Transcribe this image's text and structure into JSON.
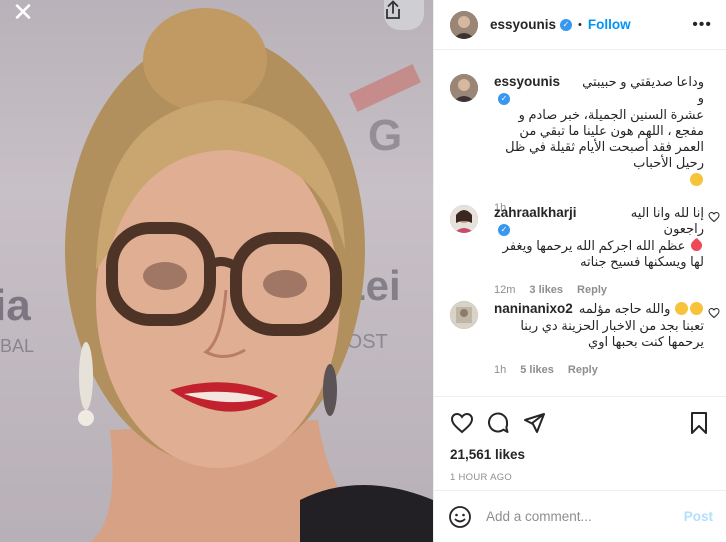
{
  "post": {
    "photo_icons": {
      "close": "close-icon",
      "share": "share-icon"
    }
  },
  "header": {
    "username": "essyounis",
    "separator": "•",
    "follow_label": "Follow",
    "more_icon": "more-options-icon"
  },
  "caption": {
    "username": "essyounis",
    "line1": "وداعا صديقتي و حبيبتي و",
    "text": "عشرة السنين الجميلة، خبر صادم و مفجع ، اللهم هون علينا ما تبقي من العمر فقد أصبحت الأيام ثقيلة في ظل رحيل الأحباب",
    "time": "1h"
  },
  "comments": [
    {
      "username": "zahraalkharji",
      "line1": "إنا لله وانا اليه راجعون",
      "text": "عظم الله اجركم الله يرحمها ويغفر لها ويسكنها فسيح جناته",
      "time": "12m",
      "likes": "3 likes",
      "reply": "Reply"
    },
    {
      "username": "naninanixo2",
      "line1": "والله حاجه مؤلمه",
      "text": "تعبنا بجد من الاخبار الحزينة دي ربنا يرحمها كنت بحبها اوي",
      "time": "1h",
      "likes": "5 likes",
      "reply": "Reply"
    }
  ],
  "actions": {
    "icons": [
      "heart-icon",
      "comment-icon",
      "share-icon",
      "bookmark-icon"
    ],
    "likes": "21,561 likes",
    "timestamp": "1 HOUR AGO"
  },
  "add_comment": {
    "placeholder": "Add a comment...",
    "post_label": "Post"
  },
  "colors": {
    "accent": "#0095f6",
    "verified": "#3897f0",
    "muted": "#8e8e8e",
    "post_disabled": "#b2dffc",
    "heart_red": "#ed4956"
  }
}
